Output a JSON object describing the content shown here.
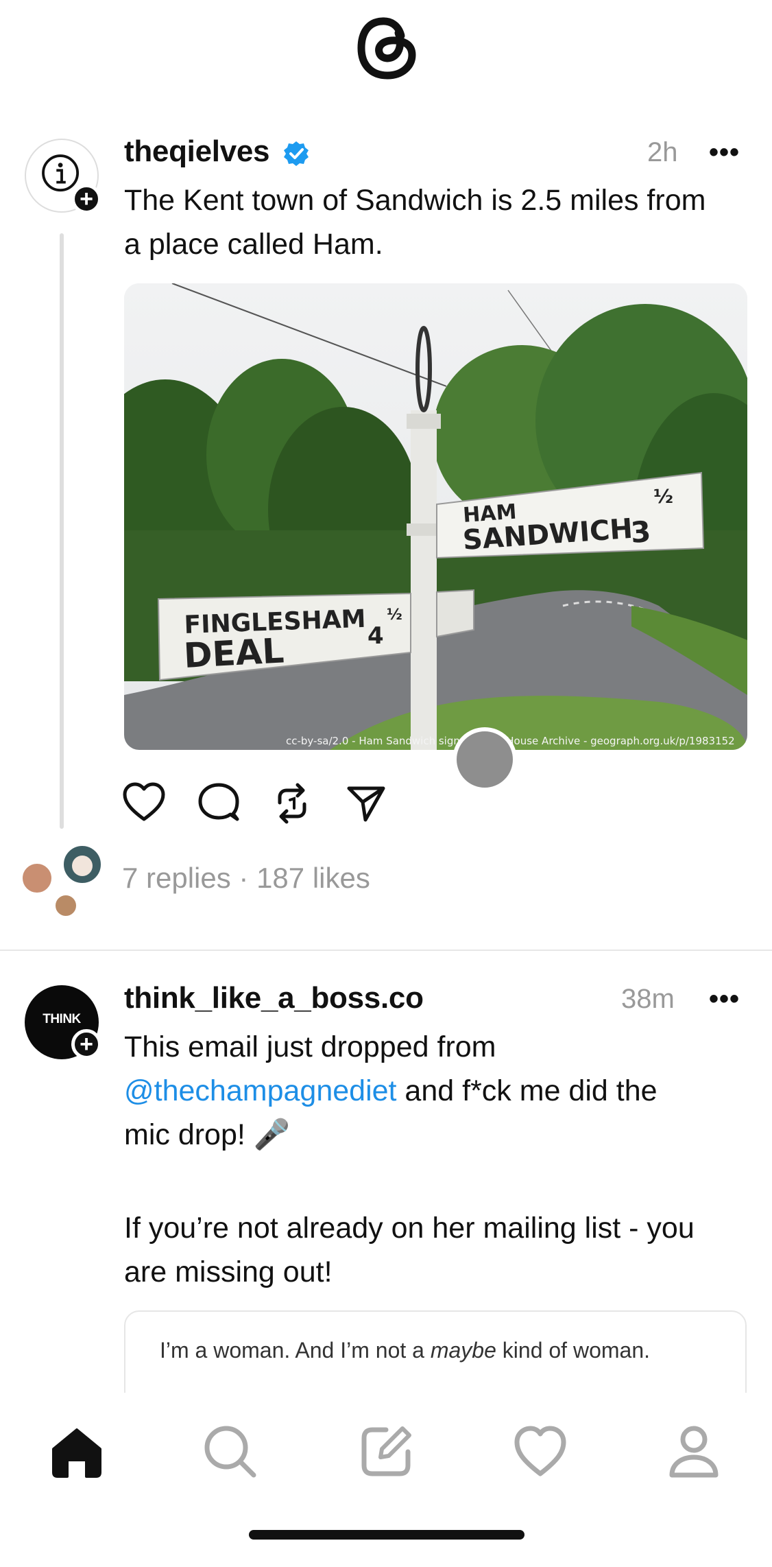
{
  "header": {
    "logo_icon": "threads-logo-icon"
  },
  "posts": [
    {
      "username": "theqielves",
      "verified": true,
      "time": "2h",
      "more_label": "•••",
      "text_lines": [
        "The Kent town of Sandwich is 2.5 miles from",
        "a place called Ham."
      ],
      "image": {
        "sign_right_line1": "HAM",
        "sign_right_line2": "SANDWICH",
        "sign_right_num": "3",
        "sign_right_frac": "½",
        "sign_left_line1": "FINGLESHAM",
        "sign_left_line2": "DEAL",
        "sign_left_num": "4",
        "sign_left_frac": "½",
        "attribution": "cc-by-sa/2.0 - Ham Sandwich sign by Oast House Archive - geograph.org.uk/p/1983152"
      },
      "actions": [
        "heart-icon",
        "comment-icon",
        "repost-icon",
        "share-icon"
      ],
      "stats": "7 replies · 187 likes"
    },
    {
      "username": "think_like_a_boss.co",
      "time": "38m",
      "more_label": "•••",
      "avatar_text": "THINK",
      "text_line1": "This email just dropped from",
      "mention": "@thechampagnediet",
      "text_line2_rest": " and f*ck me did the",
      "text_line3": "mic drop! 🎤",
      "text_line4": "If you’re not already on her mailing list - you",
      "text_line5": "are missing out!",
      "quote_before": "I’m a woman. And I’m not a ",
      "quote_italic": "maybe",
      "quote_after": " kind of woman."
    }
  ],
  "bottom_nav": [
    "home-icon",
    "search-icon",
    "compose-icon",
    "activity-heart-icon",
    "profile-icon"
  ],
  "colors": {
    "accent_link": "#1d8ee6",
    "verified": "#1d9bf0",
    "muted": "#999999"
  }
}
